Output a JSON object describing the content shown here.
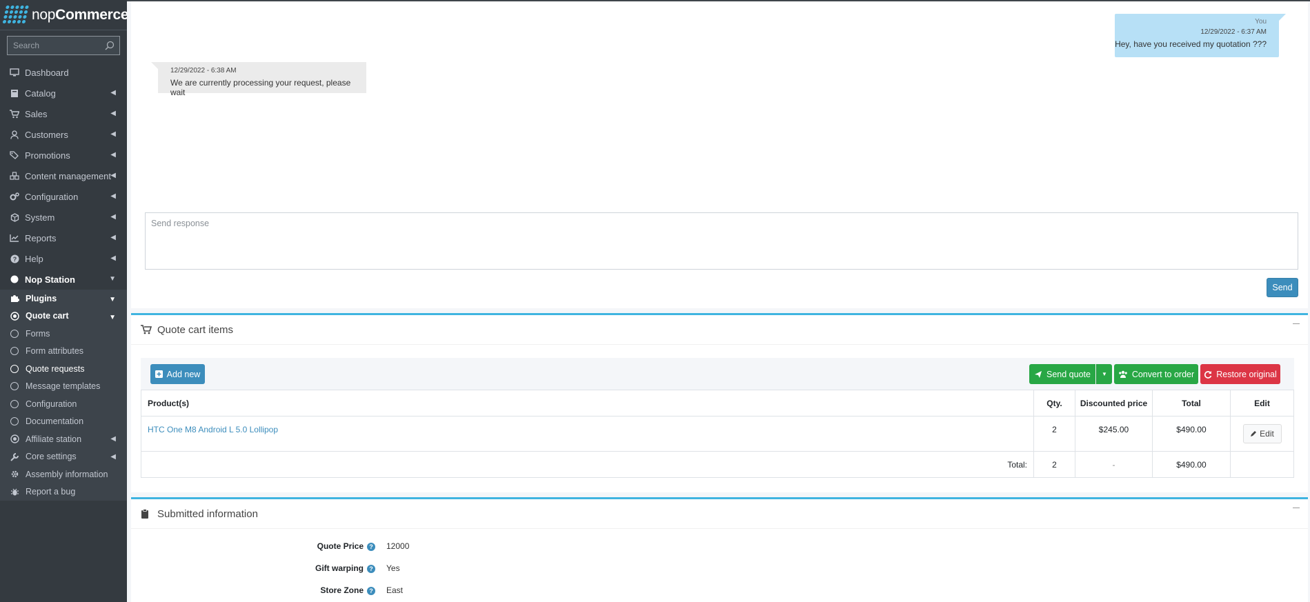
{
  "brand": {
    "prefix": "nop",
    "suffix": "Commerce"
  },
  "search": {
    "placeholder": "Search"
  },
  "sidebar": {
    "items": [
      {
        "label": "Dashboard",
        "icon": "monitor-icon"
      },
      {
        "label": "Catalog",
        "icon": "book-icon"
      },
      {
        "label": "Sales",
        "icon": "cart-icon"
      },
      {
        "label": "Customers",
        "icon": "user-icon"
      },
      {
        "label": "Promotions",
        "icon": "tags-icon"
      },
      {
        "label": "Content management",
        "icon": "cubes-icon"
      },
      {
        "label": "Configuration",
        "icon": "gears-icon"
      },
      {
        "label": "System",
        "icon": "cube-icon"
      },
      {
        "label": "Reports",
        "icon": "chart-icon"
      },
      {
        "label": "Help",
        "icon": "question-icon"
      }
    ],
    "nop_station": "Nop Station",
    "plugins": "Plugins",
    "quote_cart": "Quote cart",
    "sub_items": [
      "Forms",
      "Form attributes",
      "Quote requests",
      "Message templates",
      "Configuration",
      "Documentation"
    ],
    "affiliate": "Affiliate station",
    "core_settings": "Core settings",
    "assembly": "Assembly information",
    "report_bug": "Report a bug"
  },
  "chat": {
    "you": {
      "who": "You",
      "timestamp": "12/29/2022 - 6:37 AM",
      "message": "Hey, have you received my quotation ???"
    },
    "admin": {
      "timestamp": "12/29/2022 - 6:38 AM",
      "message": "We are currently processing your request, please wait"
    },
    "response_placeholder": "Send response",
    "send_label": "Send"
  },
  "quote_cart_items": {
    "title": "Quote cart items",
    "add_new": "Add new",
    "send_quote": "Send quote",
    "convert": "Convert to order",
    "restore": "Restore original",
    "columns": [
      "Product(s)",
      "Qty.",
      "Discounted price",
      "Total",
      "Edit"
    ],
    "row": {
      "product": "HTC One M8 Android L 5.0 Lollipop",
      "qty": "2",
      "discounted": "$245.00",
      "total": "$490.00",
      "edit": "Edit"
    },
    "totals": {
      "label": "Total:",
      "qty": "2",
      "discounted": "-",
      "total": "$490.00"
    }
  },
  "submitted": {
    "title": "Submitted information",
    "fields": [
      {
        "label": "Quote Price",
        "value": "12000"
      },
      {
        "label": "Gift warping",
        "value": "Yes"
      },
      {
        "label": "Store Zone",
        "value": "East"
      }
    ]
  },
  "colors": {
    "sidebar_bg": "#343a40",
    "accent": "#3c8dbc",
    "green": "#28a745",
    "red": "#dc3545",
    "card_top": "#3fb4e0"
  }
}
